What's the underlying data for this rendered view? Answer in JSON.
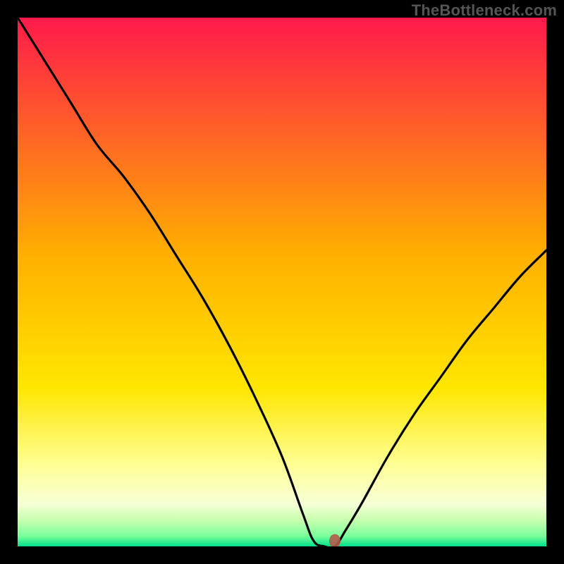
{
  "watermark": "TheBottleneck.com",
  "chart_data": {
    "type": "line",
    "title": "",
    "xlabel": "",
    "ylabel": "",
    "xlim": [
      0,
      100
    ],
    "ylim": [
      0,
      100
    ],
    "x": [
      0,
      5,
      10,
      15,
      20,
      25,
      30,
      35,
      40,
      45,
      50,
      54,
      56,
      58,
      60,
      62,
      65,
      70,
      75,
      80,
      85,
      90,
      95,
      100
    ],
    "values": [
      100,
      92,
      84,
      76,
      70,
      63,
      55,
      47,
      38,
      28,
      17,
      6,
      1,
      0,
      0,
      3,
      8,
      17,
      25,
      32,
      39,
      45,
      51,
      56
    ],
    "marker": {
      "x": 60,
      "y": 1
    },
    "annotations": [],
    "background_gradient": {
      "stops": [
        {
          "offset": 0,
          "color": "#ff1a4b"
        },
        {
          "offset": 0.45,
          "color": "#ffb000"
        },
        {
          "offset": 0.7,
          "color": "#ffe600"
        },
        {
          "offset": 0.85,
          "color": "#ffff99"
        },
        {
          "offset": 0.92,
          "color": "#f6ffd6"
        },
        {
          "offset": 0.95,
          "color": "#c8ffb0"
        },
        {
          "offset": 0.98,
          "color": "#7dff9c"
        },
        {
          "offset": 1.0,
          "color": "#00e08a"
        }
      ]
    }
  }
}
